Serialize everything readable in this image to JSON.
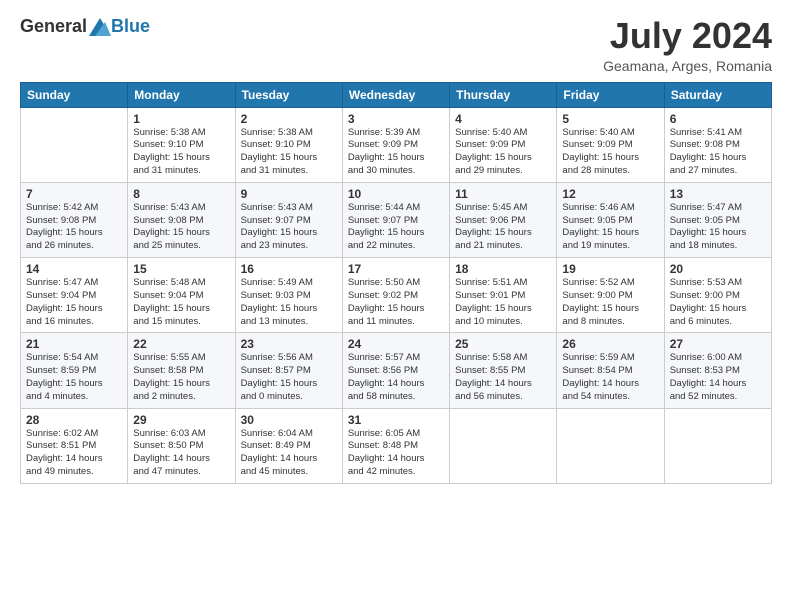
{
  "header": {
    "logo_general": "General",
    "logo_blue": "Blue",
    "month": "July 2024",
    "location": "Geamana, Arges, Romania"
  },
  "weekdays": [
    "Sunday",
    "Monday",
    "Tuesday",
    "Wednesday",
    "Thursday",
    "Friday",
    "Saturday"
  ],
  "weeks": [
    [
      {
        "day": "",
        "info": ""
      },
      {
        "day": "1",
        "info": "Sunrise: 5:38 AM\nSunset: 9:10 PM\nDaylight: 15 hours\nand 31 minutes."
      },
      {
        "day": "2",
        "info": "Sunrise: 5:38 AM\nSunset: 9:10 PM\nDaylight: 15 hours\nand 31 minutes."
      },
      {
        "day": "3",
        "info": "Sunrise: 5:39 AM\nSunset: 9:09 PM\nDaylight: 15 hours\nand 30 minutes."
      },
      {
        "day": "4",
        "info": "Sunrise: 5:40 AM\nSunset: 9:09 PM\nDaylight: 15 hours\nand 29 minutes."
      },
      {
        "day": "5",
        "info": "Sunrise: 5:40 AM\nSunset: 9:09 PM\nDaylight: 15 hours\nand 28 minutes."
      },
      {
        "day": "6",
        "info": "Sunrise: 5:41 AM\nSunset: 9:08 PM\nDaylight: 15 hours\nand 27 minutes."
      }
    ],
    [
      {
        "day": "7",
        "info": "Sunrise: 5:42 AM\nSunset: 9:08 PM\nDaylight: 15 hours\nand 26 minutes."
      },
      {
        "day": "8",
        "info": "Sunrise: 5:43 AM\nSunset: 9:08 PM\nDaylight: 15 hours\nand 25 minutes."
      },
      {
        "day": "9",
        "info": "Sunrise: 5:43 AM\nSunset: 9:07 PM\nDaylight: 15 hours\nand 23 minutes."
      },
      {
        "day": "10",
        "info": "Sunrise: 5:44 AM\nSunset: 9:07 PM\nDaylight: 15 hours\nand 22 minutes."
      },
      {
        "day": "11",
        "info": "Sunrise: 5:45 AM\nSunset: 9:06 PM\nDaylight: 15 hours\nand 21 minutes."
      },
      {
        "day": "12",
        "info": "Sunrise: 5:46 AM\nSunset: 9:05 PM\nDaylight: 15 hours\nand 19 minutes."
      },
      {
        "day": "13",
        "info": "Sunrise: 5:47 AM\nSunset: 9:05 PM\nDaylight: 15 hours\nand 18 minutes."
      }
    ],
    [
      {
        "day": "14",
        "info": "Sunrise: 5:47 AM\nSunset: 9:04 PM\nDaylight: 15 hours\nand 16 minutes."
      },
      {
        "day": "15",
        "info": "Sunrise: 5:48 AM\nSunset: 9:04 PM\nDaylight: 15 hours\nand 15 minutes."
      },
      {
        "day": "16",
        "info": "Sunrise: 5:49 AM\nSunset: 9:03 PM\nDaylight: 15 hours\nand 13 minutes."
      },
      {
        "day": "17",
        "info": "Sunrise: 5:50 AM\nSunset: 9:02 PM\nDaylight: 15 hours\nand 11 minutes."
      },
      {
        "day": "18",
        "info": "Sunrise: 5:51 AM\nSunset: 9:01 PM\nDaylight: 15 hours\nand 10 minutes."
      },
      {
        "day": "19",
        "info": "Sunrise: 5:52 AM\nSunset: 9:00 PM\nDaylight: 15 hours\nand 8 minutes."
      },
      {
        "day": "20",
        "info": "Sunrise: 5:53 AM\nSunset: 9:00 PM\nDaylight: 15 hours\nand 6 minutes."
      }
    ],
    [
      {
        "day": "21",
        "info": "Sunrise: 5:54 AM\nSunset: 8:59 PM\nDaylight: 15 hours\nand 4 minutes."
      },
      {
        "day": "22",
        "info": "Sunrise: 5:55 AM\nSunset: 8:58 PM\nDaylight: 15 hours\nand 2 minutes."
      },
      {
        "day": "23",
        "info": "Sunrise: 5:56 AM\nSunset: 8:57 PM\nDaylight: 15 hours\nand 0 minutes."
      },
      {
        "day": "24",
        "info": "Sunrise: 5:57 AM\nSunset: 8:56 PM\nDaylight: 14 hours\nand 58 minutes."
      },
      {
        "day": "25",
        "info": "Sunrise: 5:58 AM\nSunset: 8:55 PM\nDaylight: 14 hours\nand 56 minutes."
      },
      {
        "day": "26",
        "info": "Sunrise: 5:59 AM\nSunset: 8:54 PM\nDaylight: 14 hours\nand 54 minutes."
      },
      {
        "day": "27",
        "info": "Sunrise: 6:00 AM\nSunset: 8:53 PM\nDaylight: 14 hours\nand 52 minutes."
      }
    ],
    [
      {
        "day": "28",
        "info": "Sunrise: 6:02 AM\nSunset: 8:51 PM\nDaylight: 14 hours\nand 49 minutes."
      },
      {
        "day": "29",
        "info": "Sunrise: 6:03 AM\nSunset: 8:50 PM\nDaylight: 14 hours\nand 47 minutes."
      },
      {
        "day": "30",
        "info": "Sunrise: 6:04 AM\nSunset: 8:49 PM\nDaylight: 14 hours\nand 45 minutes."
      },
      {
        "day": "31",
        "info": "Sunrise: 6:05 AM\nSunset: 8:48 PM\nDaylight: 14 hours\nand 42 minutes."
      },
      {
        "day": "",
        "info": ""
      },
      {
        "day": "",
        "info": ""
      },
      {
        "day": "",
        "info": ""
      }
    ]
  ]
}
